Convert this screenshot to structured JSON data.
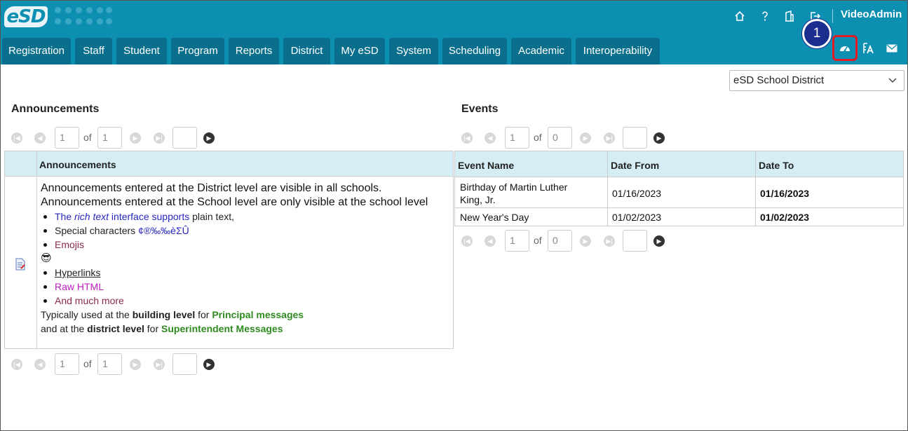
{
  "header": {
    "logo_text": "eSD",
    "username": "VideoAdmin",
    "top_icons": [
      "home-icon",
      "help-icon",
      "building-icon",
      "exit-icon"
    ],
    "right_buttons": [
      "dashboard-icon",
      "font-settings-icon",
      "mail-icon"
    ],
    "callout_number": "1"
  },
  "tabs": [
    {
      "label": "Registration"
    },
    {
      "label": "Staff"
    },
    {
      "label": "Student"
    },
    {
      "label": "Program"
    },
    {
      "label": "Reports"
    },
    {
      "label": "District"
    },
    {
      "label": "My eSD"
    },
    {
      "label": "System"
    },
    {
      "label": "Scheduling"
    },
    {
      "label": "Academic"
    },
    {
      "label": "Interoperability"
    }
  ],
  "district_select": {
    "value": "eSD School District"
  },
  "announcements": {
    "title": "Announcements",
    "column_header": "Announcements",
    "pager_top": {
      "page": "1",
      "of_label": "of",
      "total": "1",
      "goto": ""
    },
    "pager_bottom": {
      "page": "1",
      "of_label": "of",
      "total": "1",
      "goto": ""
    },
    "line1": "Announcements entered at the District level are visible in all schools.",
    "line2": "Announcements entered at the School level are only visible at the school level",
    "b1_part1": "The ",
    "b1_italic": "rich text",
    "b1_part2": " interface supports",
    "b1_part3": " plain text,",
    "b2_part1": "Special characters ",
    "b2_chars": "¢®‰‰èΣÛ",
    "b3": "Emojis",
    "emoji": "😎",
    "b4": "Hyperlinks",
    "b5": "Raw HTML",
    "b6": "And much more",
    "t1_part1": "Typically used at the ",
    "t1_bold": "building level",
    "t1_part2": " for ",
    "t1_green": "Principal messages",
    "t2_part1": "and at the ",
    "t2_bold": "district level",
    "t2_part2": " for ",
    "t2_green": "Superintendent Messages"
  },
  "events": {
    "title": "Events",
    "pager_top": {
      "page": "1",
      "of_label": "of",
      "total": "0",
      "goto": ""
    },
    "pager_bottom": {
      "page": "1",
      "of_label": "of",
      "total": "0",
      "goto": ""
    },
    "columns": [
      "Event Name",
      "Date From",
      "Date To"
    ],
    "rows": [
      {
        "name_l1": "Birthday of Martin Luther",
        "name_l2": "King, Jr.",
        "from": "01/16/2023",
        "to": "01/16/2023"
      },
      {
        "name_l1": "New Year's Day",
        "name_l2": "",
        "from": "01/02/2023",
        "to": "01/02/2023"
      }
    ]
  }
}
